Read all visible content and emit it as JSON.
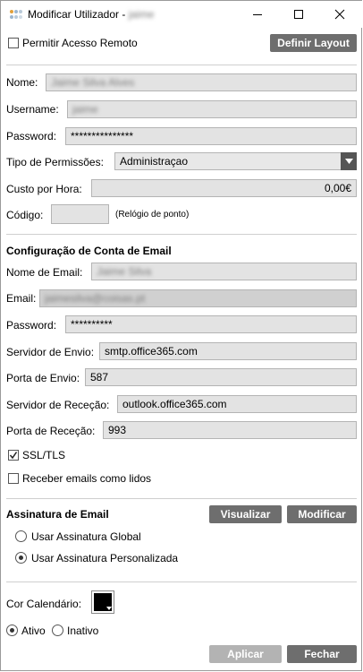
{
  "window": {
    "title_prefix": "Modificar Utilizador -",
    "title_name": "jaime",
    "app_icon": "app-icon",
    "controls": [
      "minimize-icon",
      "maximize-icon",
      "close-icon"
    ]
  },
  "top": {
    "remote_access_label": "Permitir Acesso Remoto",
    "remote_access_checked": false,
    "define_layout_label": "Definir Layout"
  },
  "user": {
    "name_label": "Nome:",
    "name_value": "Jaime Silva Alves",
    "username_label": "Username:",
    "username_value": "jaime",
    "password_label": "Password:",
    "password_value": "***************",
    "permissions_label": "Tipo de Permissões:",
    "permissions_value": "Administraçao",
    "cost_label": "Custo por Hora:",
    "cost_value": "0,00€",
    "code_label": "Código:",
    "code_value": "",
    "code_hint": "(Relógio de ponto)"
  },
  "email": {
    "section_title": "Configuração de Conta de Email",
    "email_name_label": "Nome de Email:",
    "email_name_value": "Jaime Silva",
    "email_label": "Email:",
    "email_value": "jaimesilva@coisas.pt",
    "password_label": "Password:",
    "password_value": "**********",
    "send_server_label": "Servidor de Envio:",
    "send_server_value": "smtp.office365.com",
    "send_port_label": "Porta de Envio:",
    "send_port_value": "587",
    "receive_server_label": "Servidor de Receção:",
    "receive_server_value": "outlook.office365.com",
    "receive_port_label": "Porta de Receção:",
    "receive_port_value": "993",
    "ssl_label": "SSL/TLS",
    "ssl_checked": true,
    "read_label": "Receber emails como lidos",
    "read_checked": false
  },
  "signature": {
    "section_title": "Assinatura de Email",
    "preview_label": "Visualizar",
    "modify_label": "Modificar",
    "global_label": "Usar Assinatura Global",
    "custom_label": "Usar Assinatura Personalizada",
    "selected": "custom"
  },
  "calendar": {
    "color_label": "Cor Calendário:",
    "color": "#000000"
  },
  "status": {
    "active_label": "Ativo",
    "inactive_label": "Inativo",
    "selected": "active"
  },
  "footer": {
    "apply_label": "Aplicar",
    "close_label": "Fechar"
  },
  "colors": {
    "button": "#6e6e6e",
    "button_disabled": "#b3b3b3",
    "field": "#e3e3e3"
  }
}
